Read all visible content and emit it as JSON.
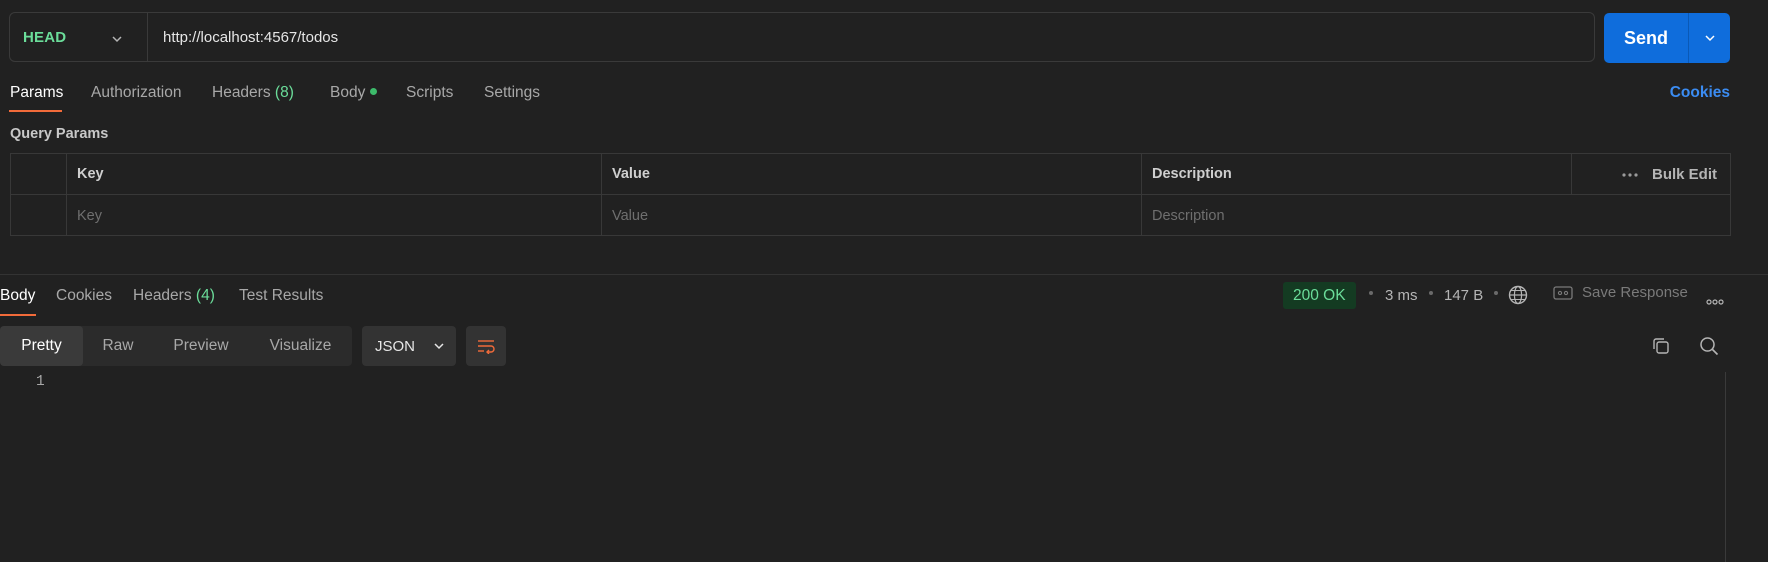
{
  "request": {
    "method": "HEAD",
    "url": "http://localhost:4567/todos",
    "send_label": "Send"
  },
  "request_tabs": [
    {
      "label": "Params",
      "active": true
    },
    {
      "label": "Authorization"
    },
    {
      "label": "Headers",
      "count": "(8)"
    },
    {
      "label": "Body",
      "indicator": true
    },
    {
      "label": "Scripts"
    },
    {
      "label": "Settings"
    }
  ],
  "cookies_label": "Cookies",
  "query_params": {
    "title": "Query Params",
    "columns": [
      "Key",
      "Value",
      "Description"
    ],
    "bulk_edit_label": "Bulk Edit",
    "placeholders": {
      "key": "Key",
      "value": "Value",
      "description": "Description"
    }
  },
  "response": {
    "tabs": [
      {
        "label": "Body",
        "active": true
      },
      {
        "label": "Cookies"
      },
      {
        "label": "Headers",
        "count": "(4)"
      },
      {
        "label": "Test Results"
      }
    ],
    "status": "200 OK",
    "time": "3 ms",
    "size": "147 B",
    "save_label": "Save Response",
    "views": [
      "Pretty",
      "Raw",
      "Preview",
      "Visualize"
    ],
    "active_view": "Pretty",
    "format": "JSON",
    "line_numbers": [
      "1"
    ]
  },
  "colors": {
    "accent": "#f26b3a",
    "method": "#6bdd9a",
    "send": "#0f6ddc",
    "link": "#3b8cf2",
    "status_bg": "#143b22"
  }
}
